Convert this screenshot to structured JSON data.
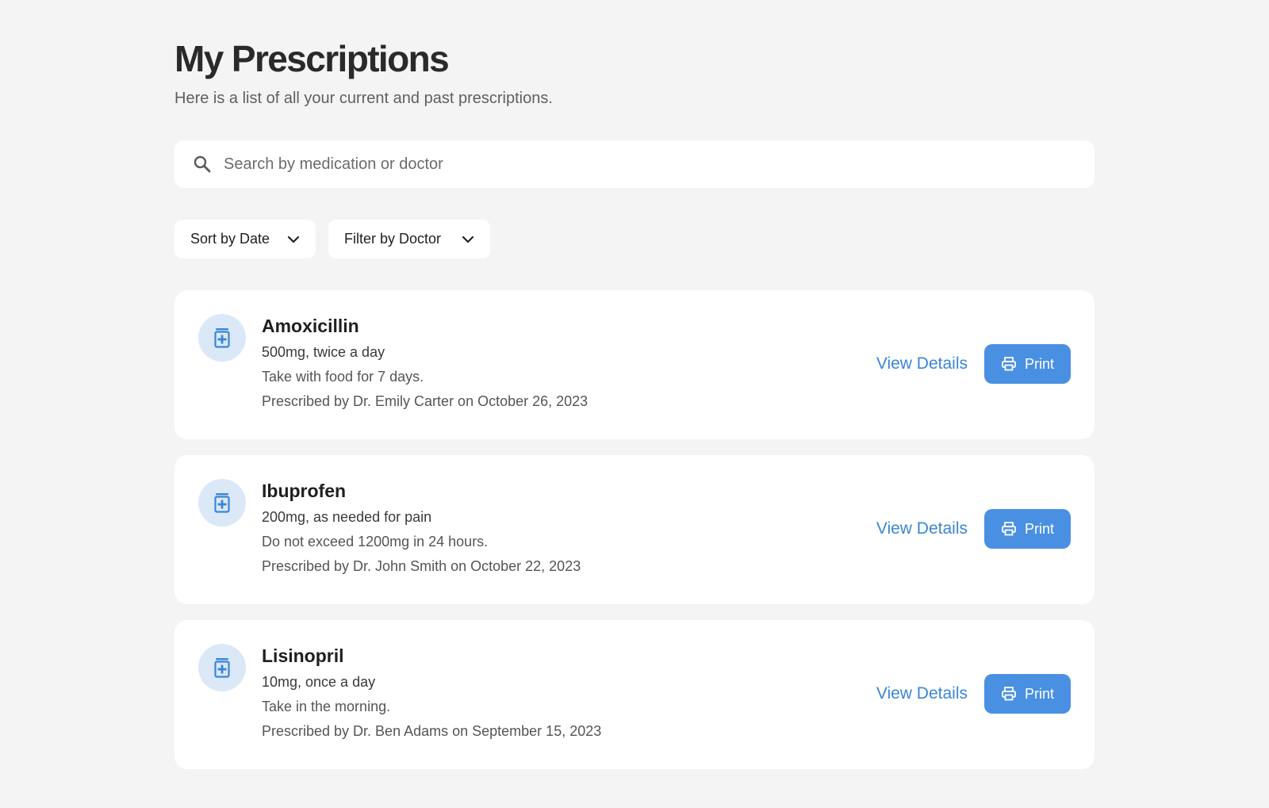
{
  "header": {
    "title": "My Prescriptions",
    "subtitle": "Here is a list of all your current and past prescriptions."
  },
  "search": {
    "placeholder": "Search by medication or doctor",
    "icon": "search-icon"
  },
  "filters": {
    "sort_label": "Sort by Date",
    "filter_label": "Filter by Doctor"
  },
  "colors": {
    "accent": "#4a90e2",
    "link": "#3a86d6",
    "icon_bg": "#dbe8f8",
    "background": "#f4f4f4"
  },
  "prescriptions": [
    {
      "name": "Amoxicillin",
      "dosage": "500mg, twice a day",
      "note": "Take with food for 7 days.",
      "prescriber": "Prescribed by Dr. Emily Carter on October 26, 2023",
      "view_label": "View Details",
      "print_label": "Print"
    },
    {
      "name": "Ibuprofen",
      "dosage": "200mg, as needed for pain",
      "note": "Do not exceed 1200mg in 24 hours.",
      "prescriber": "Prescribed by Dr. John Smith on October 22, 2023",
      "view_label": "View Details",
      "print_label": "Print"
    },
    {
      "name": "Lisinopril",
      "dosage": "10mg, once a day",
      "note": "Take in the morning.",
      "prescriber": "Prescribed by Dr. Ben Adams on September 15, 2023",
      "view_label": "View Details",
      "print_label": "Print"
    }
  ]
}
